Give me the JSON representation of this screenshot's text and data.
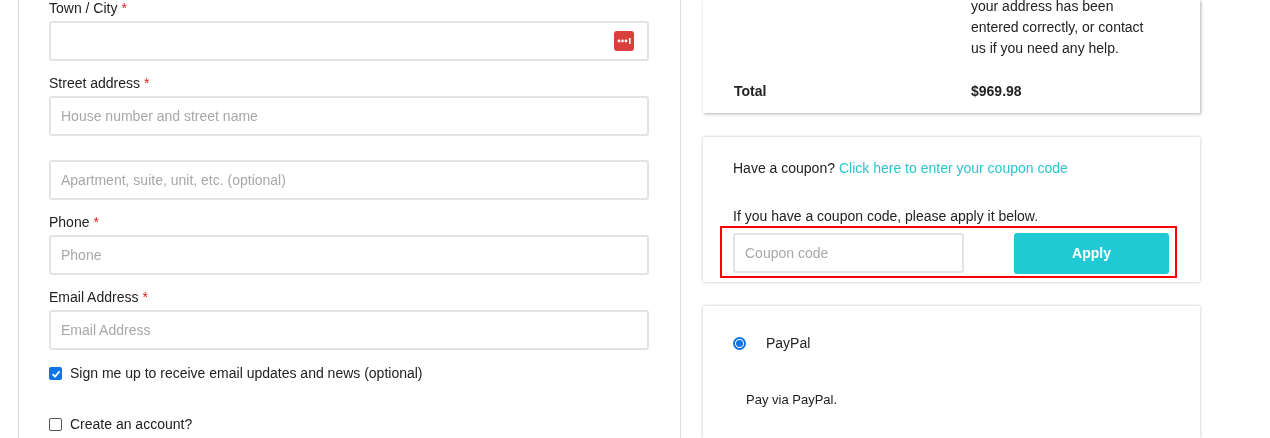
{
  "fields": [
    {
      "label": "Town / City",
      "required_mark": "*",
      "autofill_icon": true
    },
    {
      "label": "Street address",
      "required_mark": "*",
      "placeholder": "House number and street name"
    },
    {
      "placeholder": "Apartment, suite, unit, etc. (optional)"
    },
    {
      "label": "Phone",
      "required_mark": "*",
      "placeholder": "Phone"
    },
    {
      "label": "Email Address",
      "required_mark": "*",
      "placeholder": "Email Address"
    }
  ],
  "checkboxes": [
    {
      "label": "Sign me up to receive email updates and news (optional)",
      "checked": true
    },
    {
      "label": "Create an account?",
      "checked": false
    }
  ],
  "order_summary": {
    "note": "your address has been entered correctly, or contact us if you need any help.",
    "total_label": "Total",
    "total_value": "$969.98"
  },
  "coupon": {
    "prompt": "Have a coupon?",
    "link": "Click here to enter your coupon code",
    "instruction": "If you have a coupon code, please apply it below.",
    "placeholder": "Coupon code",
    "button": "Apply",
    "highlighted": true
  },
  "payment_methods": [
    {
      "label": "PayPal",
      "selected": true,
      "description": "Pay via PayPal."
    }
  ]
}
